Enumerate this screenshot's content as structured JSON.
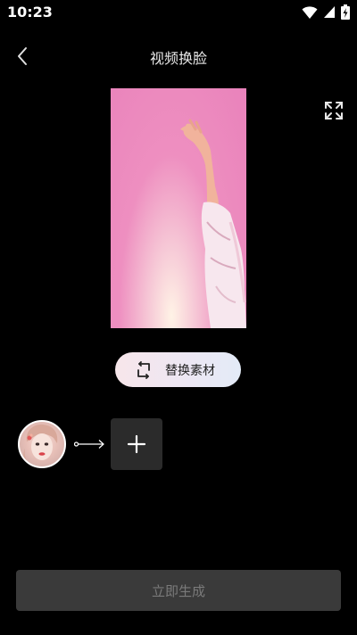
{
  "status_bar": {
    "time": "10:23",
    "icons": [
      "wifi-icon",
      "cellular-signal-icon",
      "battery-charging-icon"
    ]
  },
  "header": {
    "back_icon": "chevron-left-icon",
    "title": "视频换脸"
  },
  "preview": {
    "fullscreen_icon": "fullscreen-icon",
    "description": ""
  },
  "replace_material": {
    "icon": "swap-icon",
    "label": "替换素材"
  },
  "face_swap": {
    "source_avatar": "face-avatar",
    "arrow_icon": "long-arrow-right-icon",
    "add_icon": "plus-icon"
  },
  "generate": {
    "label": "立即生成",
    "enabled": false
  },
  "colors": {
    "background": "#000000",
    "button_disabled": "#3a3a3a",
    "button_disabled_text": "#7a7a7a",
    "pill_gradient_start": "#f7e6ea",
    "pill_gradient_end": "#e3ebf7",
    "add_tile": "#2b2b2b"
  }
}
